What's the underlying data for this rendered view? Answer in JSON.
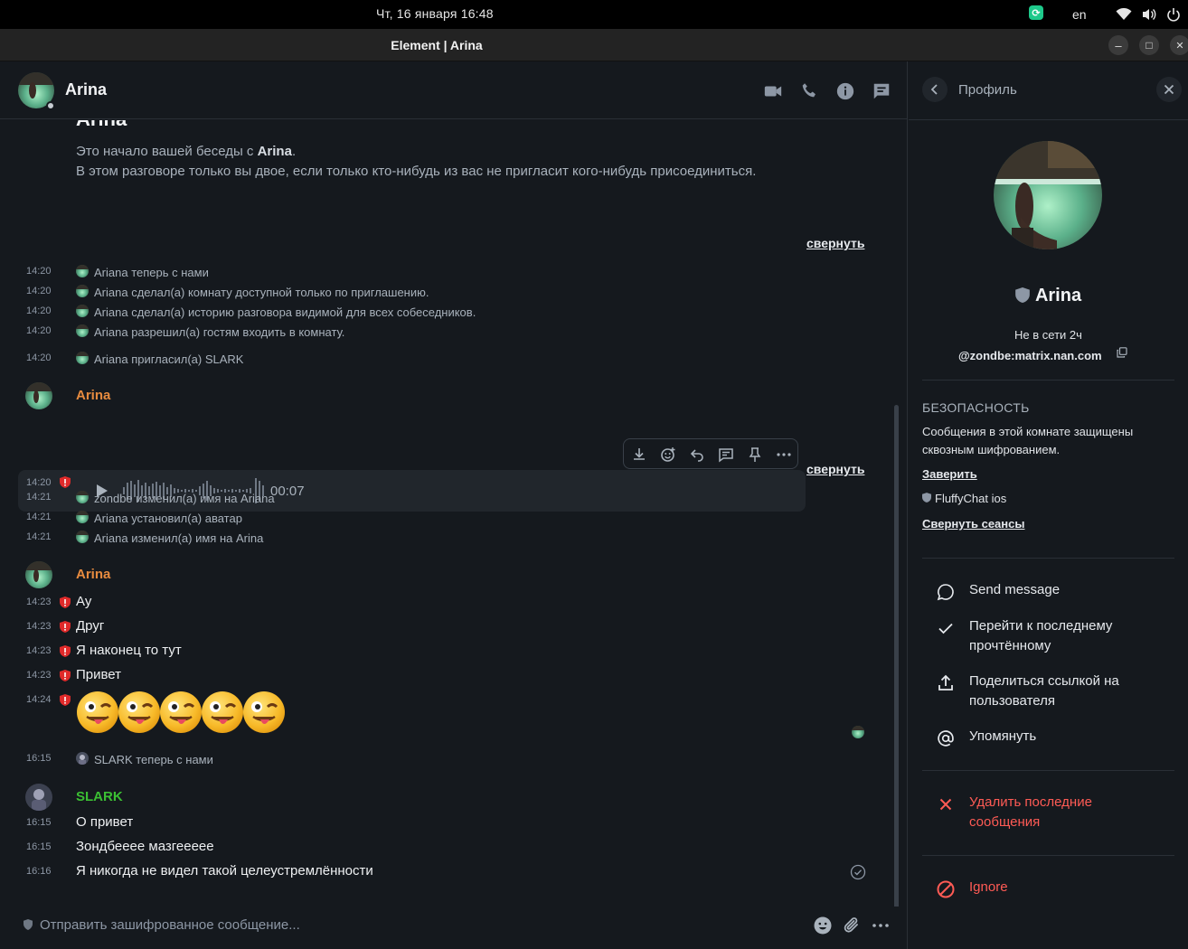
{
  "system_bar": {
    "clock": "Чт, 16 января  16:48",
    "language": "en"
  },
  "window": {
    "title": "Element | Arina",
    "minimize": "–",
    "maximize": "□",
    "close": "✕"
  },
  "room": {
    "name": "Arina"
  },
  "timeline": {
    "intro_heading_partial": "Arina",
    "intro_line1_prefix": "Это начало вашей беседы с ",
    "intro_line1_name": "Arina",
    "intro_line1_suffix": ".",
    "intro_line2": "В этом разговоре только вы двое, если только кто-нибудь из вас не пригласит кого-нибудь присоединиться.",
    "collapse_label": "свернуть",
    "events_group1": [
      {
        "time": "14:20",
        "text": "Ariana теперь с нами"
      },
      {
        "time": "14:20",
        "text": "Ariana сделал(а) комнату доступной только по приглашению."
      },
      {
        "time": "14:20",
        "text": "Ariana сделал(а) историю разговора видимой для всех собеседников."
      },
      {
        "time": "14:20",
        "text": "Ariana разрешил(а) гостям входить в комнату."
      },
      {
        "time": "14:20",
        "text": "Ariana пригласил(а) SLARK"
      }
    ],
    "voice_sender": "Arina",
    "voice_time": "14:20",
    "voice_duration": "00:07",
    "events_group2": [
      {
        "time": "14:21",
        "text": "zondbe изменил(а) имя на Ariana"
      },
      {
        "time": "14:21",
        "text": "Ariana установил(а) аватар"
      },
      {
        "time": "14:21",
        "text": "Ariana изменил(а) имя на Arina"
      }
    ],
    "arina_sender": "Arina",
    "arina_messages": [
      {
        "time": "14:23",
        "text": "Ау"
      },
      {
        "time": "14:23",
        "text": "Друг"
      },
      {
        "time": "14:23",
        "text": "Я наконец то тут"
      },
      {
        "time": "14:23",
        "text": "Привет"
      }
    ],
    "emoji_time": "14:24",
    "slark_join": {
      "time": "16:15",
      "text": "SLARK теперь с нами"
    },
    "slark_sender": "SLARK",
    "slark_messages": [
      {
        "time": "16:15",
        "text": "О привет"
      },
      {
        "time": "16:15",
        "text": "Зондбееее мазгеееее"
      },
      {
        "time": "16:16",
        "text": "Я никогда не видел такой целеустремлённости"
      }
    ]
  },
  "composer": {
    "placeholder": "Отправить зашифрованное сообщение..."
  },
  "profile": {
    "title": "Профиль",
    "name": "Arina",
    "status": "Не в сети 2ч",
    "mxid": "@zondbe:matrix.nan.com",
    "security_heading": "БЕЗОПАСНОСТЬ",
    "security_desc": "Сообщения в этой комнате защищены сквозным шифрованием.",
    "verify_label": "Заверить",
    "device": "FluffyChat ios",
    "collapse_sessions": "Свернуть сеансы",
    "actions": {
      "send_message": "Send message",
      "jump_to_read": "Перейти к последнему прочтённому",
      "share_link": "Поделиться ссылкой на пользователя",
      "mention": "Упомянуть",
      "remove_recent": "Удалить последние сообщения",
      "ignore": "Ignore"
    }
  },
  "colors": {
    "arina_name": "#e78b3f",
    "slark_name": "#3bbf33",
    "danger": "#ff5b55",
    "shield_red": "#e02a2a"
  }
}
